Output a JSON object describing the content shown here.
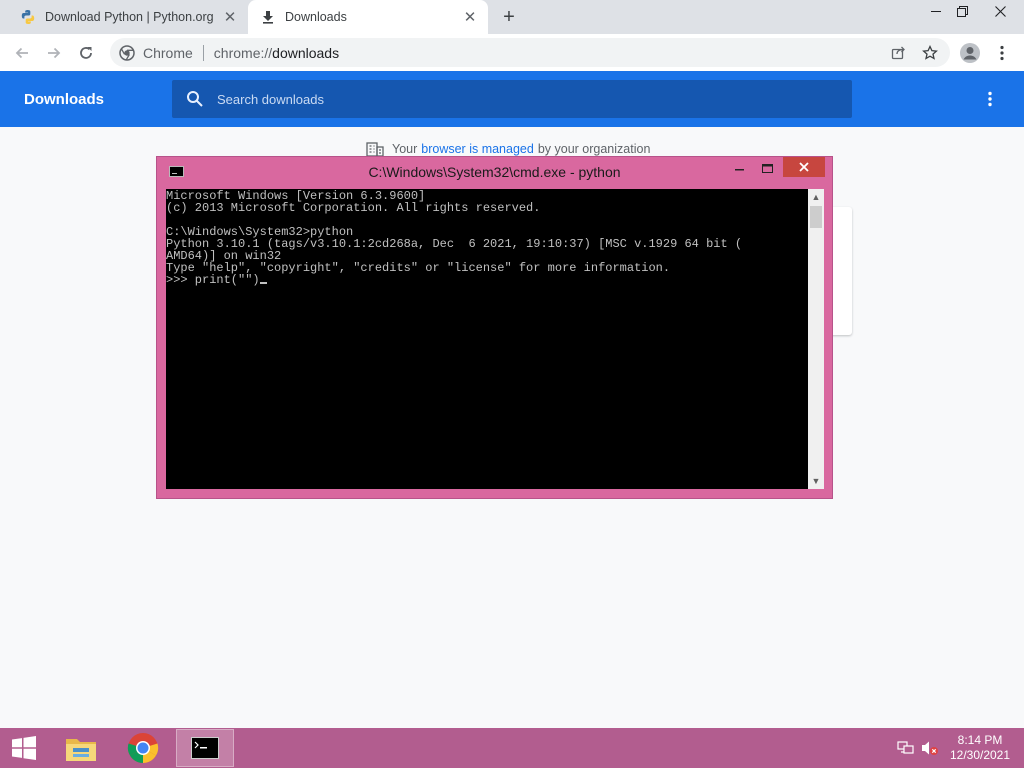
{
  "browser": {
    "tabs": [
      {
        "title": "Download Python | Python.org",
        "active": false,
        "favicon": "python-logo-icon"
      },
      {
        "title": "Downloads",
        "active": true,
        "favicon": "download-icon"
      }
    ],
    "new_tab_label": "+",
    "omnibox": {
      "scheme_label": "Chrome",
      "url_scheme": "chrome://",
      "url_path": "downloads"
    }
  },
  "downloads_page": {
    "title": "Downloads",
    "search_placeholder": "Search downloads",
    "managed_notice": {
      "prefix": "Your",
      "link": "browser is managed",
      "suffix": "by your organization"
    }
  },
  "cmd_window": {
    "title": "C:\\Windows\\System32\\cmd.exe - python",
    "lines": [
      "Microsoft Windows [Version 6.3.9600]",
      "(c) 2013 Microsoft Corporation. All rights reserved.",
      "",
      "C:\\Windows\\System32>python",
      "Python 3.10.1 (tags/v3.10.1:2cd268a, Dec  6 2021, 19:10:37) [MSC v.1929 64 bit (",
      "AMD64)] on win32",
      "Type \"help\", \"copyright\", \"credits\" or \"license\" for more information."
    ],
    "prompt": ">>> print(\"\")"
  },
  "taskbar": {
    "apps": [
      "file-explorer-icon",
      "chrome-icon",
      "command-prompt-icon"
    ],
    "clock_time": "8:14 PM",
    "clock_date": "12/30/2021"
  },
  "colors": {
    "chrome_blue": "#1a73e8",
    "taskbar": "#b25d8f",
    "cmd_frame": "#d9689f",
    "close_red": "#c7463f"
  }
}
